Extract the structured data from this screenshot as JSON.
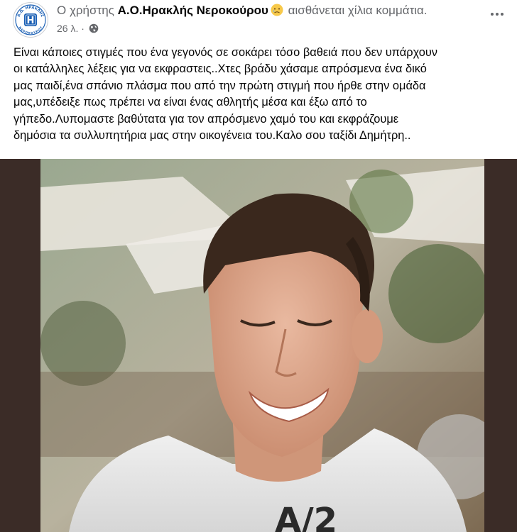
{
  "post": {
    "header": {
      "prefix": "Ο χρήστης ",
      "page_name": "Α.Ο.Ηρακλής Νεροκούρου",
      "feeling": " αισθάνεται χίλια κομμάτια.",
      "feeling_icon": "broken-heart-face-emoji"
    },
    "meta": {
      "time": "26 λ. · ",
      "audience_icon": "globe-icon"
    },
    "avatar": {
      "logo_top_text": "Α.Ο. ΗΡΑΚΛΗΣ",
      "logo_letter": "H",
      "logo_bottom_text": "ΝΕΡΟΚΟΥΡΟΥ"
    },
    "body_text": "Είναι κάποιες στιγμές που ένα γεγονός σε σοκάρει τόσο βαθειά που δεν υπάρχουν\nοι κατάλληλες λέξεις για να εκφραστεις..Χτες βράδυ χάσαμε απρόσμενα ένα δικό\nμας παιδί,ένα σπάνιο πλάσμα που από την πρώτη στιγμή που ήρθε στην ομάδα\nμας,υπέδειξε πως πρέπει  να είναι ένας αθλητής μέσα και έξω από το\nγήπεδο.Λυπομαστε βαθύτατα για τον απρόσμενο χαμό του και εκφράζουμε\nδημόσια τα συλλυπητήρια μας στην οικογένεια του.Καλο σου ταξίδι Δημήτρη..",
    "photo_text": "A/2",
    "colors": {
      "text_primary": "#050505",
      "text_secondary": "#65676b",
      "photo_border": "#3b2c27",
      "logo_blue": "#1a5fb4"
    }
  }
}
